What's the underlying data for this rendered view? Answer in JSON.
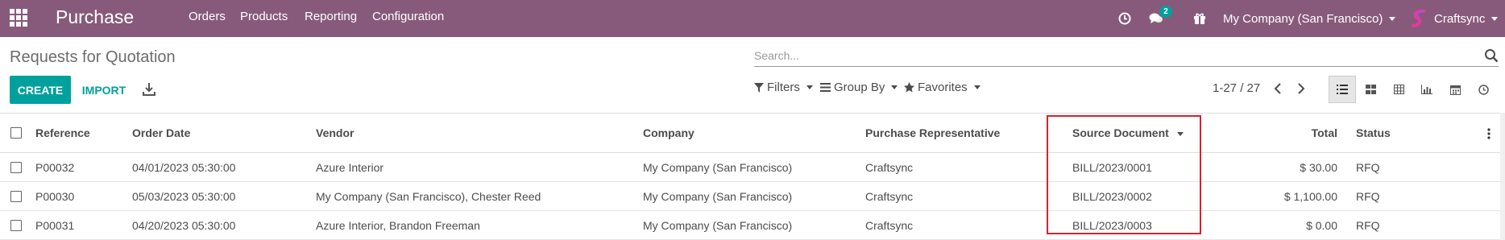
{
  "navbar": {
    "app_title": "Purchase",
    "menu": [
      "Orders",
      "Products",
      "Reporting",
      "Configuration"
    ],
    "messages_count": "2",
    "company": "My Company (San Francisco)",
    "user": "Craftsync",
    "bg_color": "#875a7b"
  },
  "control_panel": {
    "title": "Requests for Quotation",
    "search_placeholder": "Search...",
    "create_label": "CREATE",
    "import_label": "IMPORT",
    "filters_label": "Filters",
    "groupby_label": "Group By",
    "favorites_label": "Favorites",
    "pager": "1-27 / 27",
    "views": [
      "list-icon",
      "kanban-icon",
      "pivot-icon",
      "graph-icon",
      "calendar-icon",
      "activity-icon"
    ],
    "accent_color": "#00a09d"
  },
  "table": {
    "columns": {
      "reference": "Reference",
      "order_date": "Order Date",
      "vendor": "Vendor",
      "company": "Company",
      "representative": "Purchase Representative",
      "source": "Source Document",
      "total": "Total",
      "status": "Status"
    },
    "rows": [
      {
        "reference": "P00032",
        "order_date": "04/01/2023 05:30:00",
        "vendor": "Azure Interior",
        "company": "My Company (San Francisco)",
        "representative": "Craftsync",
        "source": "BILL/2023/0001",
        "total": "$ 30.00",
        "status": "RFQ"
      },
      {
        "reference": "P00030",
        "order_date": "05/03/2023 05:30:00",
        "vendor": "My Company (San Francisco), Chester Reed",
        "company": "My Company (San Francisco)",
        "representative": "Craftsync",
        "source": "BILL/2023/0002",
        "total": "$ 1,100.00",
        "status": "RFQ"
      },
      {
        "reference": "P00031",
        "order_date": "04/20/2023 05:30:00",
        "vendor": "Azure Interior, Brandon Freeman",
        "company": "My Company (San Francisco)",
        "representative": "Craftsync",
        "source": "BILL/2023/0003",
        "total": "$ 0.00",
        "status": "RFQ"
      }
    ],
    "highlight_color": "#d9232d"
  }
}
